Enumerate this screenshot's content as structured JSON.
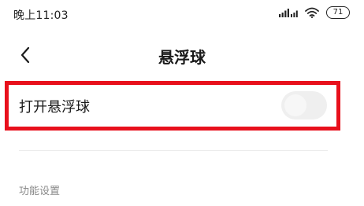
{
  "status_bar": {
    "time": "晚上11:03",
    "battery": "71",
    "signal_icon": "signal-icon",
    "wifi_icon": "wifi-icon",
    "battery_icon": "battery-icon"
  },
  "header": {
    "back_icon": "chevron-left-icon",
    "title": "悬浮球"
  },
  "toggle": {
    "label": "打开悬浮球",
    "state": "off"
  },
  "section": {
    "title": "功能设置"
  },
  "colors": {
    "highlight": "#e8101c",
    "toggle_off": "#efefef",
    "section_text": "#8a8a8a"
  }
}
